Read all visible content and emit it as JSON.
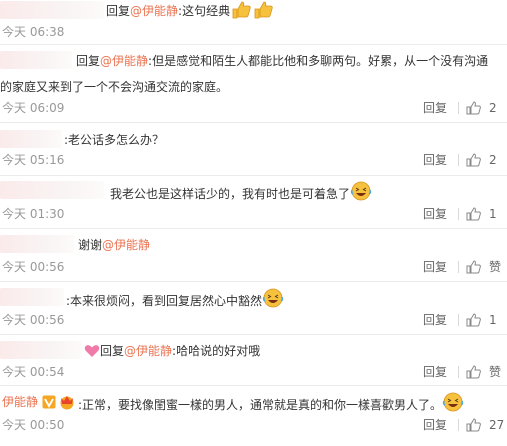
{
  "comments": [
    {
      "reply_prefix": "回复",
      "mention": "@伊能静",
      "text": ":这句经典",
      "time": "今天 06:38",
      "reply_label": "",
      "like_label": ""
    },
    {
      "reply_prefix": "回复",
      "mention": "@伊能静",
      "text": ":但是感觉和陌生人都能比他和多聊两句。好累，从一个没有沟通",
      "text2": "的家庭又来到了一个不会沟通交流的家庭。",
      "time": "今天 06:09",
      "reply_label": "回复",
      "like_label": "2"
    },
    {
      "text": ":老公话多怎么办？",
      "time": "今天 05:16",
      "reply_label": "回复",
      "like_label": "2"
    },
    {
      "text": "我老公也是这样话少的，我有时也是可着急了",
      "time": "今天 01:30",
      "reply_label": "回复",
      "like_label": "1"
    },
    {
      "reply_prefix": "谢谢",
      "mention": "@伊能静",
      "time": "今天 00:56",
      "reply_label": "回复",
      "like_label": "赞"
    },
    {
      "text": ":本来很烦闷，看到回复居然心中豁然",
      "time": "今天 00:56",
      "reply_label": "回复",
      "like_label": "1"
    },
    {
      "reply_prefix": "回复",
      "mention": "@伊能静",
      "text": ":哈哈说的好对哦",
      "time": "今天 00:54",
      "reply_label": "回复",
      "like_label": "赞"
    },
    {
      "author": "伊能静",
      "text": ":正常，要找像閨蜜一樣的男人，通常就是真的和你一樣喜歡男人了。",
      "time": "今天 00:50",
      "reply_label": "回复",
      "like_label": "27"
    }
  ],
  "colors": {
    "mention": "#eb7350",
    "meta": "#999999",
    "divider": "#ececec",
    "emoji_face": "#f6c23e",
    "heart": "#f07aa8",
    "badge": "#f5a623"
  },
  "icons": {
    "like": "thumbs-up-icon",
    "laugh": "laughing-face-emoji",
    "thumbs": "thumbs-up-emoji",
    "heart": "heart-emoji",
    "verified": "verified-v-badge-icon",
    "crown": "vip-crown-icon"
  }
}
